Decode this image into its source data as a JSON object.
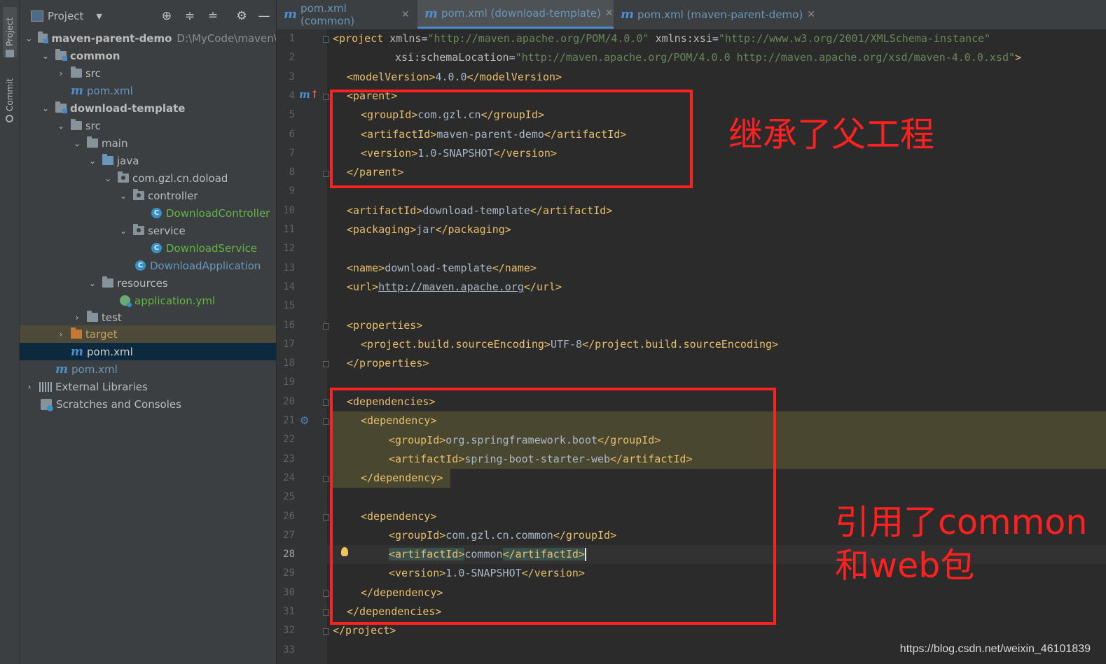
{
  "sidebar_tabs": {
    "project": "Project",
    "commit": "Commit"
  },
  "project_panel": {
    "title": "Project",
    "tree": [
      {
        "label": "maven-parent-demo",
        "path": "D:\\MyCode\\maven\\r"
      },
      {
        "label": "common"
      },
      {
        "label": "src"
      },
      {
        "label": "pom.xml"
      },
      {
        "label": "download-template"
      },
      {
        "label": "src"
      },
      {
        "label": "main"
      },
      {
        "label": "java"
      },
      {
        "label": "com.gzl.cn.doload"
      },
      {
        "label": "controller"
      },
      {
        "label": "DownloadController"
      },
      {
        "label": "service"
      },
      {
        "label": "DownloadService"
      },
      {
        "label": "DownloadApplication"
      },
      {
        "label": "resources"
      },
      {
        "label": "application.yml"
      },
      {
        "label": "test"
      },
      {
        "label": "target"
      },
      {
        "label": "pom.xml"
      },
      {
        "label": "pom.xml"
      },
      {
        "label": "External Libraries"
      },
      {
        "label": "Scratches and Consoles"
      }
    ]
  },
  "tabs": [
    {
      "label": "pom.xml (common)"
    },
    {
      "label": "pom.xml (download-template)"
    },
    {
      "label": "pom.xml (maven-parent-demo)"
    }
  ],
  "editor": {
    "current_line": "28",
    "line_numbers": [
      "1",
      "2",
      "3",
      "4",
      "5",
      "6",
      "7",
      "8",
      "9",
      "10",
      "11",
      "12",
      "13",
      "14",
      "15",
      "16",
      "17",
      "18",
      "19",
      "20",
      "21",
      "22",
      "23",
      "24",
      "25",
      "26",
      "27",
      "28",
      "29",
      "30",
      "31",
      "32",
      "33"
    ],
    "code": {
      "l1_tag": "project",
      "l1_attr1": "xmlns",
      "l1_val1": "\"http://maven.apache.org/POM/4.0.0\"",
      "l1_attr2": "xmlns:xsi",
      "l1_val2": "\"http://www.w3.org/2001/XMLSchema-instance\"",
      "l2_attr": "xsi:schemaLocation",
      "l2_val": "\"http://maven.apache.org/POM/4.0.0 http://maven.apache.org/xsd/maven-4.0.0.xsd\"",
      "modelVersion": "4.0.0",
      "parent_groupId": "com.gzl.cn",
      "parent_artifactId": "maven-parent-demo",
      "parent_version": "1.0-SNAPSHOT",
      "artifactId": "download-template",
      "packaging": "jar",
      "name": "download-template",
      "url": "http://maven.apache.org",
      "sourceEncoding": "UTF-8",
      "dep1_groupId": "org.springframework.boot",
      "dep1_artifactId": "spring-boot-starter-web",
      "dep2_groupId": "com.gzl.cn.common",
      "dep2_artifactId": "common",
      "dep2_version": "1.0-SNAPSHOT"
    }
  },
  "annotations": {
    "parent_note": "继承了父工程",
    "deps_note_line1": "引用了common",
    "deps_note_line2": "和web包"
  },
  "watermark": "https://blog.csdn.net/weixin_46101839",
  "colors": {
    "annotation_red": "#ff2020",
    "accent_blue": "#4a88c7",
    "tag_yellow": "#e8bf6a",
    "string_green": "#6a8759"
  }
}
